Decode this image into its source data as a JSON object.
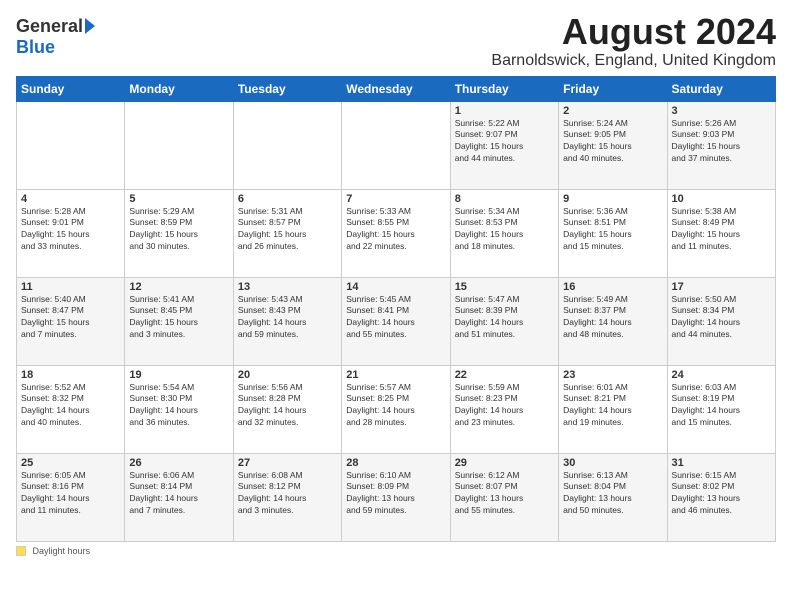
{
  "logo": {
    "general": "General",
    "blue": "Blue"
  },
  "title": {
    "month_year": "August 2024",
    "location": "Barnoldswick, England, United Kingdom"
  },
  "days_header": [
    "Sunday",
    "Monday",
    "Tuesday",
    "Wednesday",
    "Thursday",
    "Friday",
    "Saturday"
  ],
  "footer": {
    "label": "Daylight hours"
  },
  "weeks": [
    [
      {
        "num": "",
        "info": ""
      },
      {
        "num": "",
        "info": ""
      },
      {
        "num": "",
        "info": ""
      },
      {
        "num": "",
        "info": ""
      },
      {
        "num": "1",
        "info": "Sunrise: 5:22 AM\nSunset: 9:07 PM\nDaylight: 15 hours\nand 44 minutes."
      },
      {
        "num": "2",
        "info": "Sunrise: 5:24 AM\nSunset: 9:05 PM\nDaylight: 15 hours\nand 40 minutes."
      },
      {
        "num": "3",
        "info": "Sunrise: 5:26 AM\nSunset: 9:03 PM\nDaylight: 15 hours\nand 37 minutes."
      }
    ],
    [
      {
        "num": "4",
        "info": "Sunrise: 5:28 AM\nSunset: 9:01 PM\nDaylight: 15 hours\nand 33 minutes."
      },
      {
        "num": "5",
        "info": "Sunrise: 5:29 AM\nSunset: 8:59 PM\nDaylight: 15 hours\nand 30 minutes."
      },
      {
        "num": "6",
        "info": "Sunrise: 5:31 AM\nSunset: 8:57 PM\nDaylight: 15 hours\nand 26 minutes."
      },
      {
        "num": "7",
        "info": "Sunrise: 5:33 AM\nSunset: 8:55 PM\nDaylight: 15 hours\nand 22 minutes."
      },
      {
        "num": "8",
        "info": "Sunrise: 5:34 AM\nSunset: 8:53 PM\nDaylight: 15 hours\nand 18 minutes."
      },
      {
        "num": "9",
        "info": "Sunrise: 5:36 AM\nSunset: 8:51 PM\nDaylight: 15 hours\nand 15 minutes."
      },
      {
        "num": "10",
        "info": "Sunrise: 5:38 AM\nSunset: 8:49 PM\nDaylight: 15 hours\nand 11 minutes."
      }
    ],
    [
      {
        "num": "11",
        "info": "Sunrise: 5:40 AM\nSunset: 8:47 PM\nDaylight: 15 hours\nand 7 minutes."
      },
      {
        "num": "12",
        "info": "Sunrise: 5:41 AM\nSunset: 8:45 PM\nDaylight: 15 hours\nand 3 minutes."
      },
      {
        "num": "13",
        "info": "Sunrise: 5:43 AM\nSunset: 8:43 PM\nDaylight: 14 hours\nand 59 minutes."
      },
      {
        "num": "14",
        "info": "Sunrise: 5:45 AM\nSunset: 8:41 PM\nDaylight: 14 hours\nand 55 minutes."
      },
      {
        "num": "15",
        "info": "Sunrise: 5:47 AM\nSunset: 8:39 PM\nDaylight: 14 hours\nand 51 minutes."
      },
      {
        "num": "16",
        "info": "Sunrise: 5:49 AM\nSunset: 8:37 PM\nDaylight: 14 hours\nand 48 minutes."
      },
      {
        "num": "17",
        "info": "Sunrise: 5:50 AM\nSunset: 8:34 PM\nDaylight: 14 hours\nand 44 minutes."
      }
    ],
    [
      {
        "num": "18",
        "info": "Sunrise: 5:52 AM\nSunset: 8:32 PM\nDaylight: 14 hours\nand 40 minutes."
      },
      {
        "num": "19",
        "info": "Sunrise: 5:54 AM\nSunset: 8:30 PM\nDaylight: 14 hours\nand 36 minutes."
      },
      {
        "num": "20",
        "info": "Sunrise: 5:56 AM\nSunset: 8:28 PM\nDaylight: 14 hours\nand 32 minutes."
      },
      {
        "num": "21",
        "info": "Sunrise: 5:57 AM\nSunset: 8:25 PM\nDaylight: 14 hours\nand 28 minutes."
      },
      {
        "num": "22",
        "info": "Sunrise: 5:59 AM\nSunset: 8:23 PM\nDaylight: 14 hours\nand 23 minutes."
      },
      {
        "num": "23",
        "info": "Sunrise: 6:01 AM\nSunset: 8:21 PM\nDaylight: 14 hours\nand 19 minutes."
      },
      {
        "num": "24",
        "info": "Sunrise: 6:03 AM\nSunset: 8:19 PM\nDaylight: 14 hours\nand 15 minutes."
      }
    ],
    [
      {
        "num": "25",
        "info": "Sunrise: 6:05 AM\nSunset: 8:16 PM\nDaylight: 14 hours\nand 11 minutes."
      },
      {
        "num": "26",
        "info": "Sunrise: 6:06 AM\nSunset: 8:14 PM\nDaylight: 14 hours\nand 7 minutes."
      },
      {
        "num": "27",
        "info": "Sunrise: 6:08 AM\nSunset: 8:12 PM\nDaylight: 14 hours\nand 3 minutes."
      },
      {
        "num": "28",
        "info": "Sunrise: 6:10 AM\nSunset: 8:09 PM\nDaylight: 13 hours\nand 59 minutes."
      },
      {
        "num": "29",
        "info": "Sunrise: 6:12 AM\nSunset: 8:07 PM\nDaylight: 13 hours\nand 55 minutes."
      },
      {
        "num": "30",
        "info": "Sunrise: 6:13 AM\nSunset: 8:04 PM\nDaylight: 13 hours\nand 50 minutes."
      },
      {
        "num": "31",
        "info": "Sunrise: 6:15 AM\nSunset: 8:02 PM\nDaylight: 13 hours\nand 46 minutes."
      }
    ]
  ]
}
